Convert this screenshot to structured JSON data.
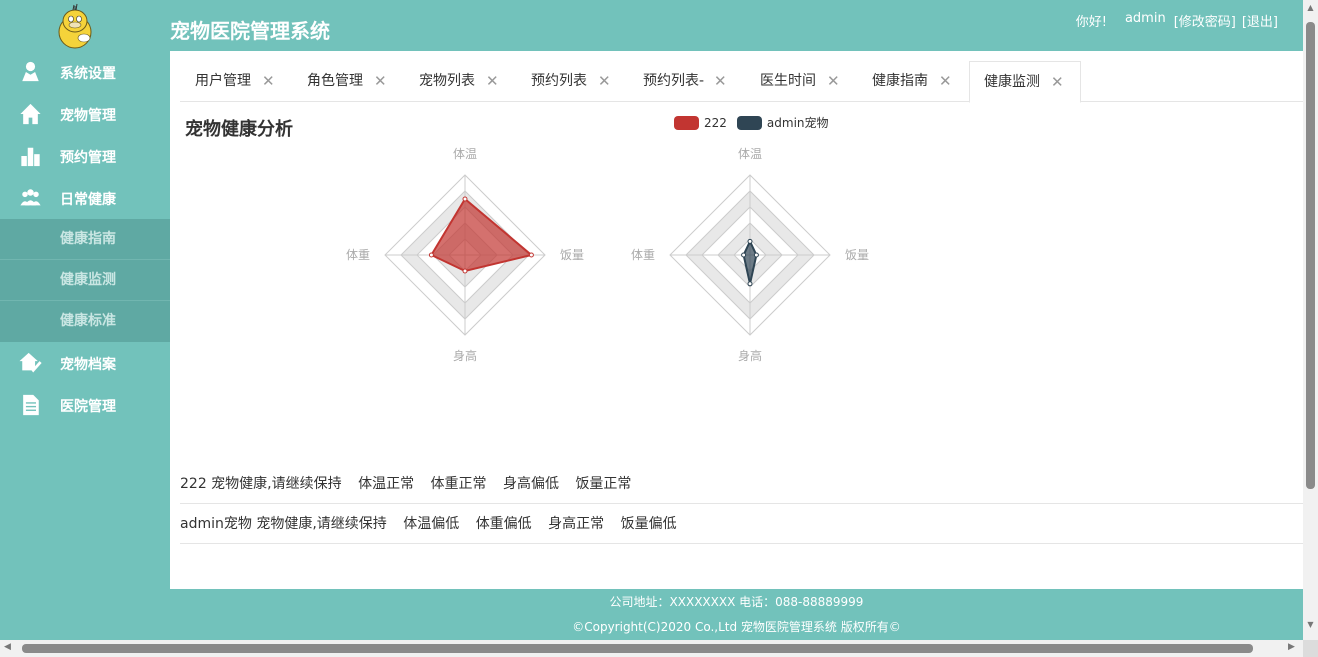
{
  "app": {
    "title": "宠物医院管理系统"
  },
  "header": {
    "greeting": "你好!",
    "username": "admin",
    "change_password": "[修改密码]",
    "logout": "[退出]"
  },
  "sidebar": {
    "items": [
      {
        "label": "系统设置",
        "icon": "user-icon"
      },
      {
        "label": "宠物管理",
        "icon": "home-icon"
      },
      {
        "label": "预约管理",
        "icon": "bar-chart-icon"
      },
      {
        "label": "日常健康",
        "icon": "group-icon"
      }
    ],
    "subitems": [
      {
        "label": "健康指南"
      },
      {
        "label": "健康监测"
      },
      {
        "label": "健康标准"
      }
    ],
    "items_after": [
      {
        "label": "宠物档案",
        "icon": "house-check-icon"
      },
      {
        "label": "医院管理",
        "icon": "document-icon"
      }
    ]
  },
  "tabs": [
    {
      "label": "用户管理"
    },
    {
      "label": "角色管理"
    },
    {
      "label": "宠物列表"
    },
    {
      "label": "预约列表"
    },
    {
      "label": "预约列表-"
    },
    {
      "label": "医生时间"
    },
    {
      "label": "健康指南"
    },
    {
      "label": "健康监测",
      "active": true
    }
  ],
  "panel": {
    "title": "宠物健康分析"
  },
  "colors": {
    "accent": "#72c2bb",
    "series1": "#c23531",
    "series2": "#2f4554"
  },
  "chart_data": {
    "type": "radar",
    "indicators": [
      "体温",
      "饭量",
      "身高",
      "体重"
    ],
    "series": [
      {
        "name": "222",
        "values": [
          0.7,
          0.83,
          0.2,
          0.42
        ]
      },
      {
        "name": "admin宠物",
        "values": [
          0.17,
          0.08,
          0.36,
          0.08
        ]
      }
    ]
  },
  "status_rows": [
    {
      "pet": "222 宠物健康,请继续保持",
      "temp": "体温正常",
      "weight": "体重正常",
      "height": "身高偏低",
      "food": "饭量正常"
    },
    {
      "pet": "admin宠物 宠物健康,请继续保持",
      "temp": "体温偏低",
      "weight": "体重偏低",
      "height": "身高正常",
      "food": "饭量偏低"
    }
  ],
  "footer": {
    "line1": "公司地址：XXXXXXXX 电话：088-88889999",
    "line2": "©Copyright(C)2020 Co.,Ltd 宠物医院管理系统 版权所有©"
  }
}
